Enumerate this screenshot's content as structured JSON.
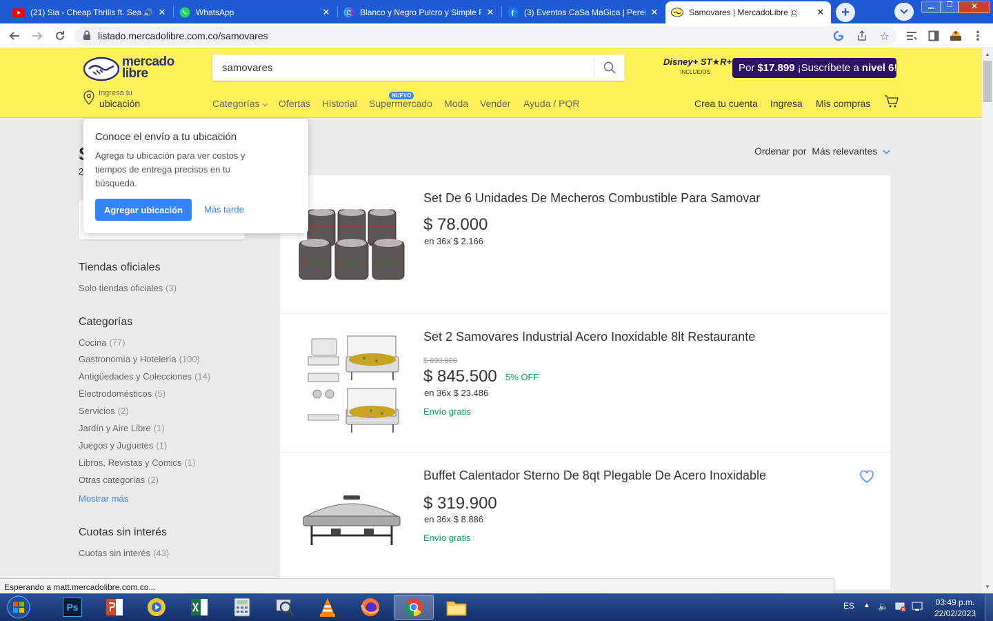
{
  "browser": {
    "tabs": [
      {
        "title": "(21) Sia - Cheap Thrills ft. Sea",
        "icon": "youtube-icon",
        "active": false
      },
      {
        "title": "WhatsApp",
        "icon": "whatsapp-icon",
        "active": false
      },
      {
        "title": "Blanco y Negro Pulcro y Simple F",
        "icon": "canva-icon",
        "active": false
      },
      {
        "title": "(3) Eventos CaSa MaGica | Pereira",
        "icon": "facebook-icon",
        "active": false
      },
      {
        "title": "Samovares | MercadoLibre 🇨",
        "icon": "mercadolibre-icon",
        "active": true
      }
    ],
    "url": "listado.mercadolibre.com.co/samovares",
    "status_text": "Esperando a matt.mercadolibre.com.co..."
  },
  "header": {
    "logo_line1": "mercado",
    "logo_line2": "libre",
    "search_value": "samovares",
    "disney_label": "Disney+ ST★R+",
    "disney_sub": "INCLUIDOS",
    "promo_prefix": "Por ",
    "promo_price": "$17.899",
    "promo_mid": " ¡Suscríbete a ",
    "promo_level": "nivel 6",
    "promo_suffix": "!",
    "location_line1": "Ingresa tu",
    "location_line2": "ubicación",
    "nav": [
      "Categorías",
      "Ofertas",
      "Historial",
      "Supermercado",
      "Moda",
      "Vender",
      "Ayuda / PQR"
    ],
    "nuevo_badge": "NUEVO",
    "right_nav": [
      "Crea tu cuenta",
      "Ingresa",
      "Mis compras"
    ]
  },
  "popover": {
    "title": "Conoce el envío a tu ubicación",
    "body_line1": "Agrega tu ubicación para ver costos y",
    "body_line2": "tiempos de entrega precisos en tu",
    "body_line3": "búsqueda.",
    "primary_button": "Agregar ubicación",
    "secondary_button": "Más tarde"
  },
  "page": {
    "title_partial": "S",
    "count_partial": "2",
    "sort_label": "Ordenar por",
    "sort_value": "Más relevantes"
  },
  "filters": {
    "official_title": "Tiendas oficiales",
    "official_item": {
      "label": "Solo tiendas oficiales",
      "count": "(3)"
    },
    "categories_title": "Categorías",
    "categories": [
      {
        "label": "Cocina",
        "count": "(77)"
      },
      {
        "label": "Gastronomía y Hotelería",
        "count": "(100)"
      },
      {
        "label": "Antigüedades y Colecciones",
        "count": "(14)"
      },
      {
        "label": "Electrodomésticos",
        "count": "(5)"
      },
      {
        "label": "Servicios",
        "count": "(2)"
      },
      {
        "label": "Jardín y Aire Libre",
        "count": "(1)"
      },
      {
        "label": "Juegos y Juguetes",
        "count": "(1)"
      },
      {
        "label": "Libros, Revistas y Comics",
        "count": "(1)"
      },
      {
        "label": "Otras categorías",
        "count": "(2)"
      }
    ],
    "show_more": "Mostrar más",
    "installments_title": "Cuotas sin interés",
    "installments_item": {
      "label": "Cuotas sin interés",
      "count": "(43)"
    }
  },
  "results": [
    {
      "title": "Set De 6 Unidades De Mecheros Combustible Para Samovar",
      "price": "$ 78.000",
      "installments": "en 36x $ 2.166",
      "shipping": "",
      "old_price": "",
      "discount": ""
    },
    {
      "title": "Set 2 Samovares Industrial Acero Inoxidable 8lt Restaurante",
      "old_price": "$ 890.000",
      "price": "$ 845.500",
      "discount": "5% OFF",
      "installments": "en 36x $ 23.486",
      "shipping": "Envío gratis"
    },
    {
      "title": "Buffet Calentador Sterno De 8qt Plegable De Acero Inoxidable",
      "price": "$ 319.900",
      "installments": "en 36x $ 8.886",
      "shipping": "Envío gratis",
      "old_price": "",
      "discount": ""
    }
  ],
  "taskbar": {
    "apps": [
      "start-icon",
      "photoshop-icon",
      "powerpoint-icon",
      "media-player-icon",
      "excel-icon",
      "calculator-icon",
      "search-magnifier-icon",
      "vlc-icon",
      "firefox-icon",
      "chrome-icon",
      "file-explorer-icon"
    ],
    "ps_label": "Ps",
    "lang": "ES",
    "time": "03:49 p.m.",
    "date": "22/02/2023"
  },
  "colors": {
    "ml_yellow": "#fff159",
    "ml_blue": "#3483fa",
    "ml_green": "#00a650",
    "chrome_blue": "#1f5ad6"
  }
}
